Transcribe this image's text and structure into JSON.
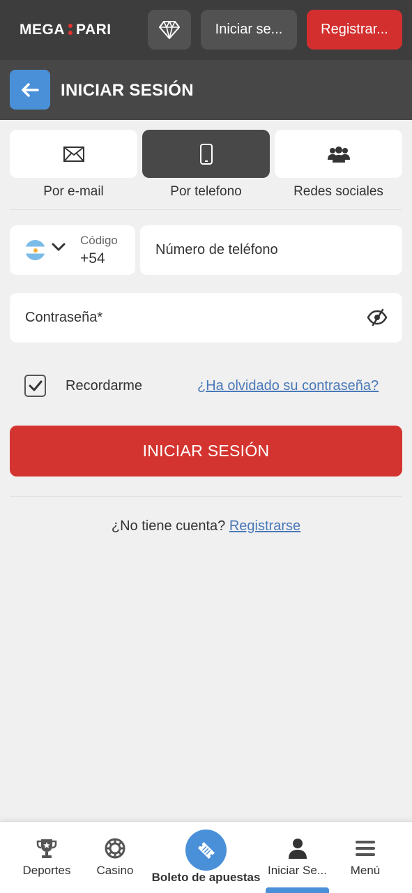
{
  "header": {
    "logo_left": "MEGA",
    "logo_right": "PARI",
    "login_label": "Iniciar se...",
    "register_label": "Registrar..."
  },
  "subheader": {
    "title": "INICIAR SESIÓN"
  },
  "methods": [
    {
      "label": "Por e-mail",
      "icon": "envelope-icon",
      "active": false
    },
    {
      "label": "Por telefono",
      "icon": "phone-icon",
      "active": true
    },
    {
      "label": "Redes sociales",
      "icon": "users-icon",
      "active": false
    }
  ],
  "form": {
    "country_flag": "argentina-flag",
    "code_label": "Código",
    "code_value": "+54",
    "phone_placeholder": "Número de teléfono",
    "password_placeholder": "Contraseña*",
    "remember_label": "Recordarme",
    "remember_checked": true,
    "forgot_label": "¿Ha olvidado su contraseña?",
    "submit_label": "INICIAR SESIÓN",
    "no_account_text": "¿No tiene cuenta?",
    "register_link": "Registrarse"
  },
  "bottom_nav": {
    "items": [
      {
        "label": "Deportes",
        "icon": "trophy-icon"
      },
      {
        "label": "Casino",
        "icon": "casino-chip-icon"
      },
      {
        "label": "Boleto de apuestas",
        "icon": "ticket-icon"
      },
      {
        "label": "Iniciar Se...",
        "icon": "user-icon",
        "active": true
      },
      {
        "label": "Menú",
        "icon": "menu-icon"
      }
    ]
  },
  "colors": {
    "header_bg": "#3d3d3d",
    "subheader_bg": "#474747",
    "accent_red": "#d4342f",
    "accent_blue": "#4a90d9",
    "link_blue": "#4a78b8",
    "page_bg": "#f0f0f0"
  }
}
